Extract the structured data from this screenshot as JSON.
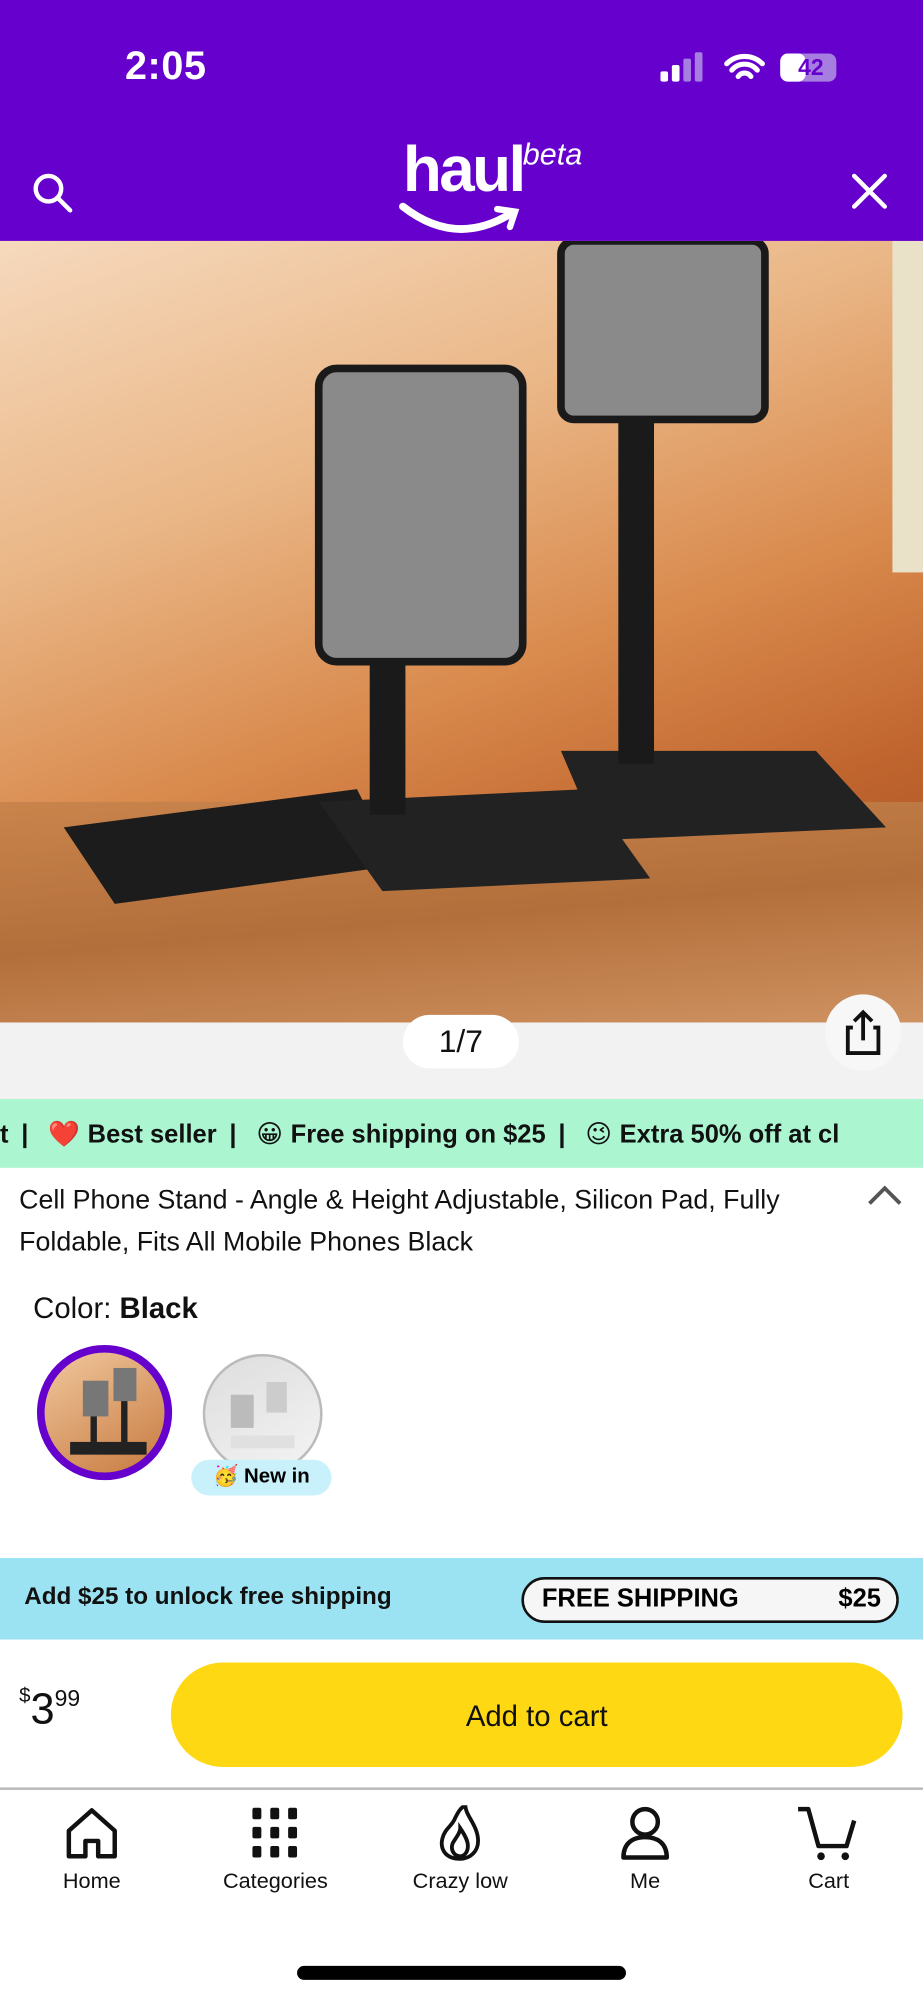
{
  "status_bar": {
    "time": "2:05",
    "battery": "42"
  },
  "header": {
    "logo": "haul",
    "logo_badge": "beta",
    "search_icon": "search-icon",
    "close_icon": "close-icon"
  },
  "gallery": {
    "counter": "1/7",
    "share_icon": "share-icon"
  },
  "ticker": {
    "items": [
      "t",
      "Best seller",
      "Free shipping on $25",
      "Extra 50% off at cl"
    ],
    "emojis": [
      "❤️",
      "😀",
      "😉"
    ]
  },
  "product": {
    "title": "Cell Phone Stand - Angle & Height Adjustable, Silicon Pad, Fully Foldable, Fits All Mobile Phones Black",
    "color_label": "Color:",
    "color_value": "Black",
    "swatches": [
      {
        "name": "Black",
        "selected": true
      },
      {
        "name": "White",
        "selected": false,
        "badge": "New in",
        "badge_emoji": "🥳"
      }
    ]
  },
  "shipping": {
    "message": "Add $25 to unlock free shipping",
    "pill_label": "FREE SHIPPING",
    "pill_amount": "$25"
  },
  "purchase": {
    "currency": "$",
    "price_whole": "3",
    "price_cents": "99",
    "add_to_cart": "Add to cart"
  },
  "nav": [
    {
      "label": "Home",
      "icon": "home-icon"
    },
    {
      "label": "Categories",
      "icon": "grid-icon"
    },
    {
      "label": "Crazy low",
      "icon": "flame-icon"
    },
    {
      "label": "Me",
      "icon": "person-icon"
    },
    {
      "label": "Cart",
      "icon": "cart-icon"
    }
  ],
  "colors": {
    "brand": "#6600cc",
    "ticker_bg": "#abf5d1",
    "shipping_bg": "#9be3f3",
    "button": "#ffd814"
  }
}
